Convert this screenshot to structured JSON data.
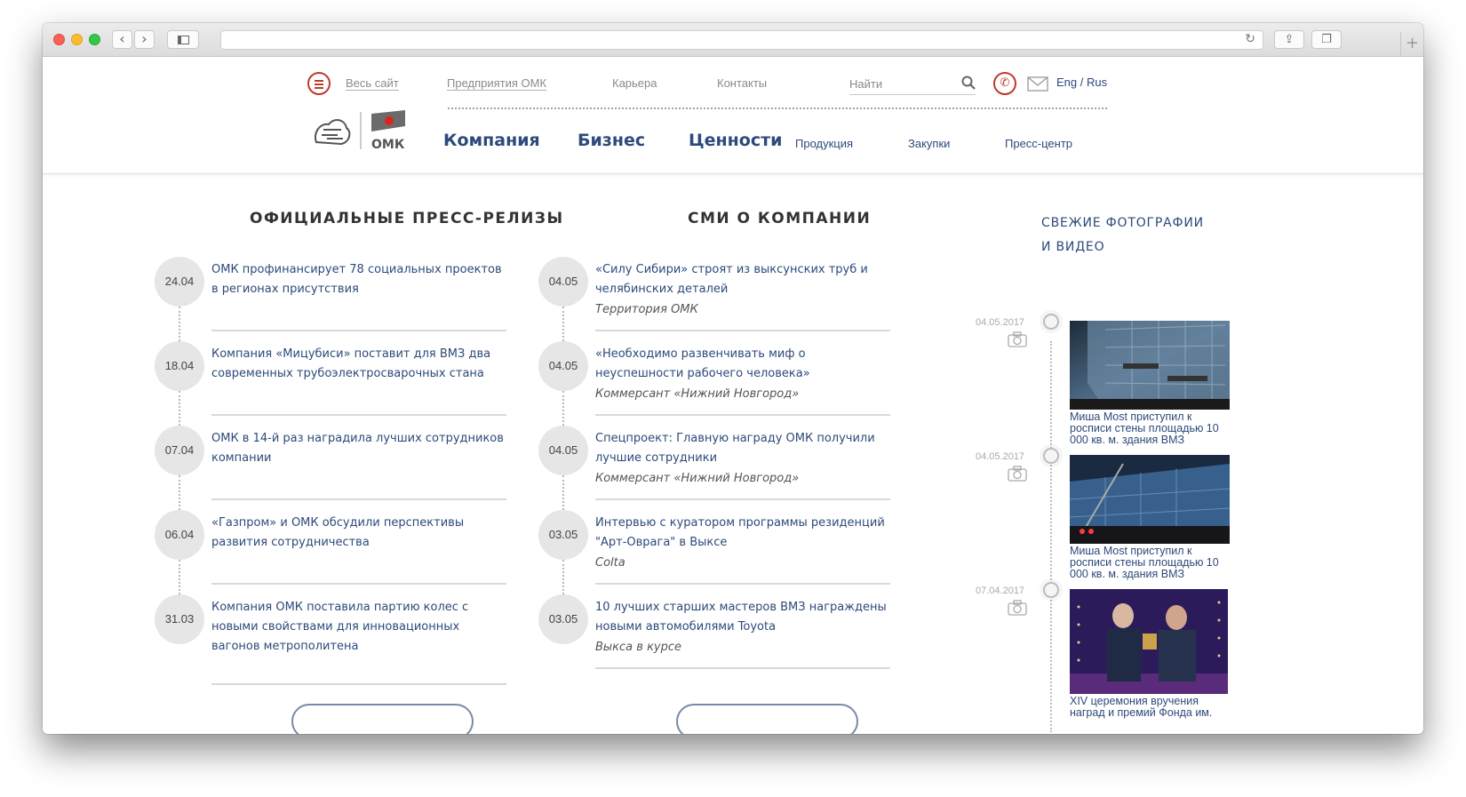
{
  "browser": {
    "address_value": ""
  },
  "header": {
    "top_links": {
      "all_site": "Весь сайт",
      "enterprises": "Предприятия ОМК",
      "career": "Карьера",
      "contacts": "Контакты"
    },
    "search": {
      "placeholder": "Найти"
    },
    "lang": {
      "eng": "Eng",
      "sep": " / ",
      "rus": "Rus"
    },
    "logo_text": "ОМК",
    "main_nav": [
      "Компания",
      "Бизнес",
      "Ценности"
    ],
    "sub_nav": [
      "Продукция",
      "Закупки",
      "Пресс-центр"
    ]
  },
  "press_releases": {
    "title": "ОФИЦИАЛЬНЫЕ ПРЕСС-РЕЛИЗЫ",
    "items": [
      {
        "date": "24.04",
        "text": "ОМК профинансирует 78 социальных проектов в регионах присутствия"
      },
      {
        "date": "18.04",
        "text": "Компания «Мицубиси» поставит для ВМЗ два современных трубоэлектросварочных стана"
      },
      {
        "date": "07.04",
        "text": "ОМК в 14-й раз наградила лучших сотрудников компании"
      },
      {
        "date": "06.04",
        "text": "«Газпром» и ОМК обсудили перспективы развития сотрудничества"
      },
      {
        "date": "31.03",
        "text": "Компания ОМК поставила партию колес с новыми свойствами для инновационных вагонов метрополитена"
      }
    ]
  },
  "media": {
    "title": "СМИ О КОМПАНИИ",
    "items": [
      {
        "date": "04.05",
        "text": "«Силу Сибири» строят из выксунских труб и челябинских деталей",
        "source": "Территория ОМК"
      },
      {
        "date": "04.05",
        "text": "«Необходимо развенчивать миф о неуспешности рабочего человека»",
        "source": "Коммерсант «Нижний Новгород»"
      },
      {
        "date": "04.05",
        "text": "Спецпроект: Главную награду ОМК получили лучшие сотрудники",
        "source": "Коммерсант «Нижний Новгород»"
      },
      {
        "date": "03.05",
        "text": "Интервью с куратором программы резиденций \"Арт-Оврага\" в Выксе",
        "source": "Colta"
      },
      {
        "date": "03.05",
        "text": "10 лучших старших мастеров ВМЗ награждены новыми автомобилями Toyota",
        "source": "Выкса в курсе"
      }
    ]
  },
  "photos": {
    "title_line1": "СВЕЖИЕ ФОТОГРАФИИ",
    "title_line2": "И ВИДЕО",
    "items": [
      {
        "date": "04.05.2017",
        "caption": "Миша Most приступил к росписи стены площадью 10 000 кв. м. здания ВМЗ"
      },
      {
        "date": "04.05.2017",
        "caption": "Миша Most приступил к росписи стены площадью 10 000 кв. м. здания ВМЗ"
      },
      {
        "date": "07.04.2017",
        "caption": "XIV церемония вручения наград и премий Фонда им."
      }
    ]
  },
  "colors": {
    "accent_red": "#c0392b",
    "link_blue": "#2c4a7a",
    "date_circle": "#e6e6e6"
  }
}
